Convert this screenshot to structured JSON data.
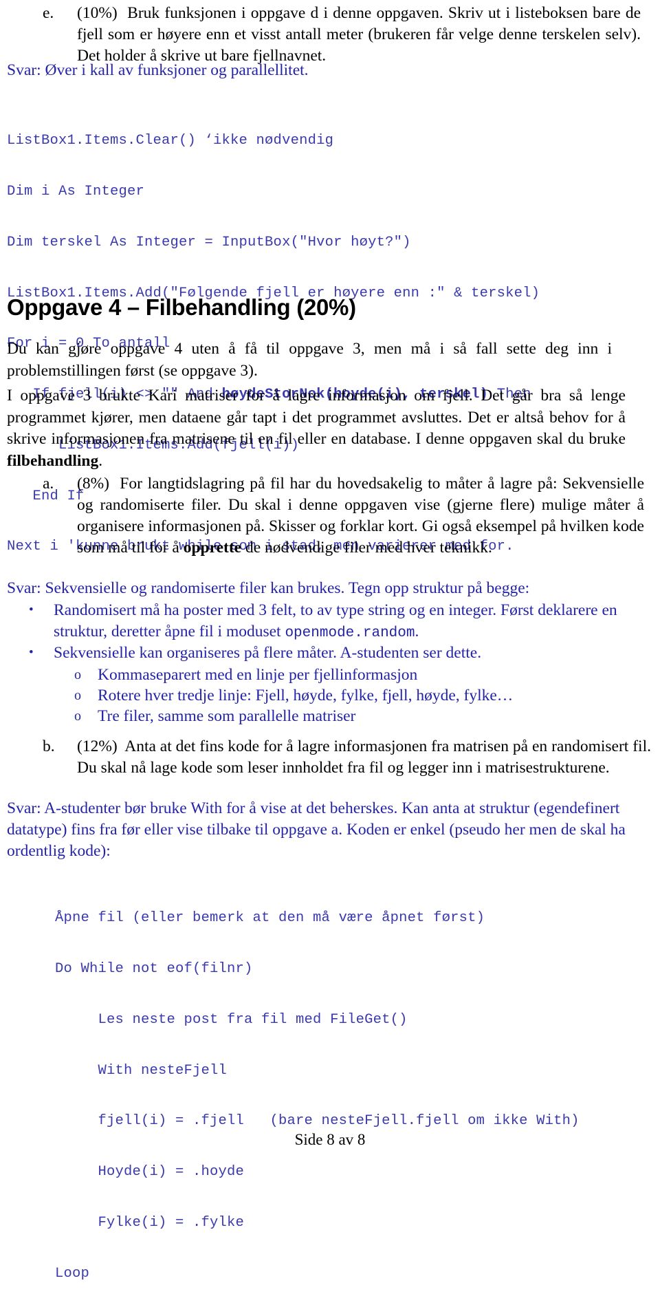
{
  "colors": {
    "answer_blue": "#2323A8",
    "code_blue": "#3A3AAE",
    "body_black": "#000000",
    "page_bg": "#ffffff"
  },
  "item_e": {
    "marker": "e.",
    "percent": "(10%)",
    "text": "Bruk funksjonen i oppgave d i denne oppgaven. Skriv ut i listeboksen bare de fjell som er høyere enn et visst antall meter (brukeren får velge denne terskelen selv). Det holder å skrive ut bare fjellnavnet."
  },
  "answer_e": {
    "text": "Svar: Øver i kall av funksjoner og parallellitet."
  },
  "code_block_1": {
    "lines": [
      {
        "pre": "ListBox1.Items.Clear() ‘ikke nødvendig",
        "bold": "",
        "post": ""
      },
      {
        "pre": "Dim i As Integer",
        "bold": "",
        "post": ""
      },
      {
        "pre": "Dim terskel As Integer = InputBox(\"Hvor høyt?\")",
        "bold": "",
        "post": ""
      },
      {
        "pre": "ListBox1.Items.Add(\"Følgende fjell er høyere enn :\" & terskel)",
        "bold": "",
        "post": ""
      },
      {
        "pre": "For i = 0 To antall",
        "bold": "",
        "post": ""
      },
      {
        "pre": "   If fjell(i) <> \"\" And ",
        "bold": "høydeStorNok(hoyde(i), terskel)",
        "post": " Then"
      },
      {
        "pre": "      ListBox1.Items.Add(fjell(i))",
        "bold": "",
        "post": ""
      },
      {
        "pre": "   End If",
        "bold": "",
        "post": ""
      },
      {
        "pre": "Next i 'kunne brukt while som i stad, men varierer med for.",
        "bold": "",
        "post": ""
      }
    ]
  },
  "heading_oppgave4": {
    "text": "Oppgave 4 – Filbehandling (20%)"
  },
  "para_1": {
    "text": "Du kan gjøre oppgave 4 uten å få til oppgave 3, men må i så fall sette deg inn i problemstillingen først (se oppgave 3)."
  },
  "para_2": {
    "part1": "I oppgave 3 brukte Kari matriser for å lagre informasjon om fjell. Det går bra så lenge programmet kjører, men dataene går tapt i det programmet avsluttes. Det er altså behov for å skrive informasjonen fra matrisene til en fil eller en database. I denne oppgaven skal du bruke ",
    "bold": "filbehandling",
    "part2": "."
  },
  "item_a": {
    "marker": "a.",
    "percent": "(8%)",
    "part1": "For langtidslagring på fil har du hovedsakelig to måter å lagre på: Sekvensielle og randomiserte filer. Du skal i denne oppgaven vise (gjerne flere) mulige måter å organisere informasjonen på. Skisser og forklar kort. Gi også eksempel på hvilken kode som må til for å ",
    "bold": "opprette",
    "part2": " de nødvendige filer med hver teknikk."
  },
  "answer_a": {
    "text": "Svar: Sekvensielle og randomiserte filer kan brukes. Tegn opp struktur på begge:"
  },
  "bullets_a": [
    {
      "marker": "•",
      "part1": "Randomisert må ha poster med 3 felt, to av type string og en integer. Først deklarere en struktur, deretter åpne fil i moduset ",
      "mono": "openmode.random",
      "part2": "."
    },
    {
      "marker": "•",
      "part1": "Sekvensielle kan organiseres på flere måter. A-studenten ser dette.",
      "mono": "",
      "part2": ""
    }
  ],
  "subbullets_a": [
    {
      "marker": "o",
      "text": "Kommaseparert med en linje per fjellinformasjon"
    },
    {
      "marker": "o",
      "text": "Rotere hver tredje linje: Fjell, høyde, fylke, fjell, høyde, fylke…"
    },
    {
      "marker": "o",
      "text": "Tre filer, samme som parallelle matriser"
    }
  ],
  "item_b": {
    "marker": "b.",
    "percent": "(12%)",
    "text": "Anta at det fins kode for å lagre informasjonen fra matrisen på en randomisert fil. Du skal nå lage kode som leser innholdet fra fil og legger inn i matrisestrukturene."
  },
  "answer_b": {
    "text": "Svar: A-studenter bør bruke With for å vise at det beherskes. Kan anta at struktur (egendefinert datatype) fins fra før eller vise tilbake til oppgave a. Koden er enkel (pseudo her men de skal ha ordentlig kode):"
  },
  "code_block_2": {
    "lines": [
      "Åpne fil (eller bemerk at den må være åpnet først)",
      "Do While not eof(filnr)",
      "     Les neste post fra fil med FileGet()",
      "     With nesteFjell",
      "     fjell(i) = .fjell   (bare nesteFjell.fjell om ikke With)",
      "     Hoyde(i) = .hoyde",
      "     Fylke(i) = .fylke",
      "Loop"
    ]
  },
  "footer": {
    "text": "Side 8 av 8"
  }
}
